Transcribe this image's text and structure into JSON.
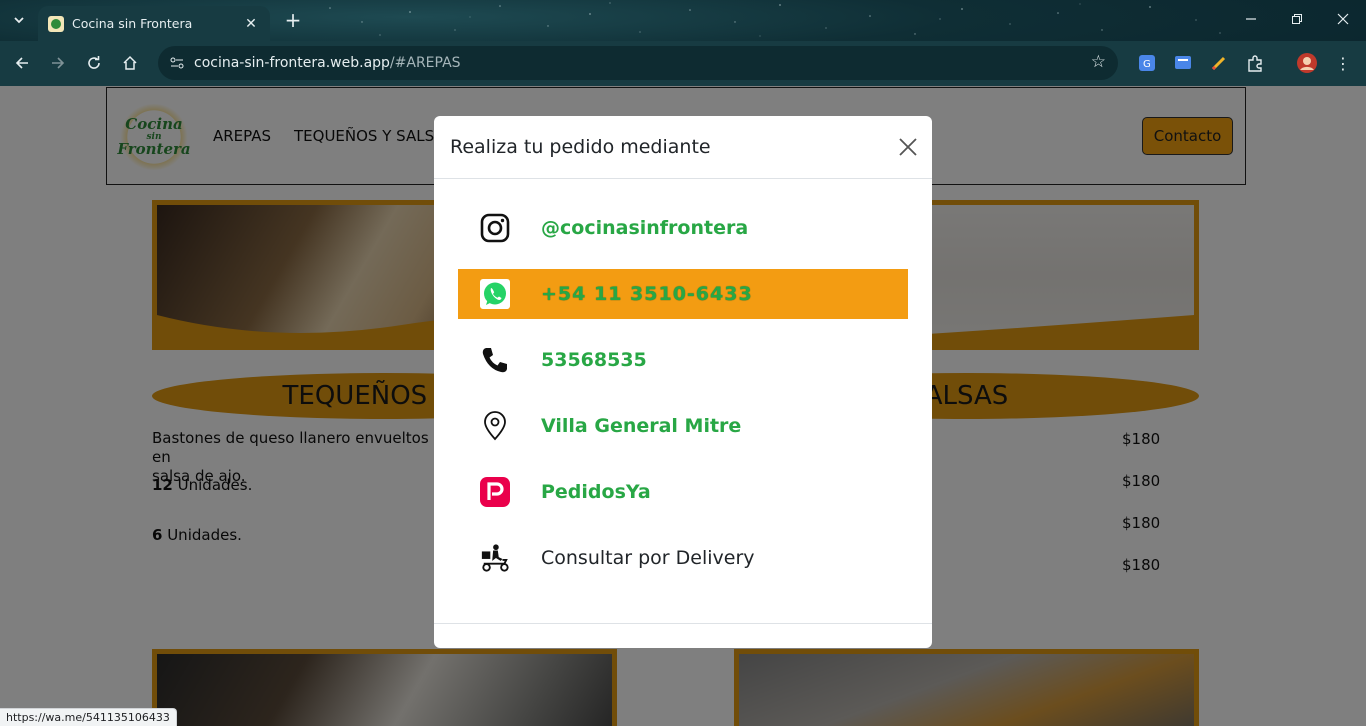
{
  "browser": {
    "tab_title": "Cocina sin Frontera",
    "url_host": "cocina-sin-frontera.web.app",
    "url_path": "/#AREPAS",
    "status_url": "https://wa.me/541135106433"
  },
  "site": {
    "logo_line1": "Cocina",
    "logo_line2": "sin",
    "logo_line3": "Frontera",
    "nav": [
      "AREPAS",
      "TEQUEÑOS Y SALSA"
    ],
    "contact_button": "Contacto",
    "section_left_title": "TEQUEÑOS CLA",
    "section_right_title": "ALSAS",
    "description_line1": "Bastones de queso llanero envueltos en",
    "description_line2": "salsa de ajo.",
    "units": [
      {
        "qty": "12",
        "label": " Unidades."
      },
      {
        "qty": "6",
        "label": " Unidades."
      }
    ],
    "prices": [
      "$180",
      "$180",
      "$180",
      "$180"
    ]
  },
  "modal": {
    "title": "Realiza tu pedido mediante",
    "items": [
      {
        "icon": "instagram-icon",
        "label": "@cocinasinfrontera"
      },
      {
        "icon": "whatsapp-icon",
        "label": "+54 11 3510-6433"
      },
      {
        "icon": "phone-icon",
        "label": "53568535"
      },
      {
        "icon": "location-pin-icon",
        "label": "Villa General Mitre"
      },
      {
        "icon": "pedidosya-icon",
        "label": "PedidosYa"
      },
      {
        "icon": "delivery-scooter-icon",
        "label": "Consultar por Delivery"
      }
    ],
    "colors": {
      "highlight": "#f39c12",
      "link_green": "#28a745",
      "brand_gold": "#e29a12"
    }
  }
}
